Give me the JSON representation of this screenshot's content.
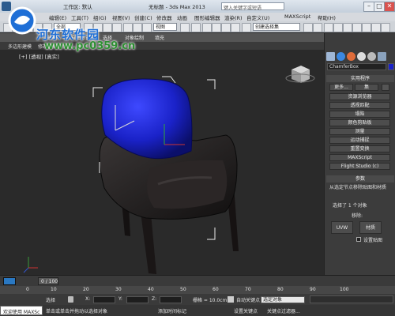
{
  "title_bar": {
    "workspace_label": "工作区: 默认",
    "file_title": "无标题 - 3ds Max 2013",
    "search_placeholder": "键入关键字或短语",
    "minimize": "–",
    "maximize": "□",
    "close": "✕"
  },
  "menu": {
    "items": [
      "编辑(E)",
      "工具(T)",
      "组(G)",
      "视图(V)",
      "创建(C)",
      "修改器",
      "动画",
      "图形编辑器",
      "渲染(R)",
      "自定义(U)",
      "MAXScript",
      "帮助(H)"
    ]
  },
  "toolbar": {
    "filter_combo": "全部",
    "view_combo": "视图",
    "selection_set": "创建选择集"
  },
  "ribbon": {
    "items": [
      "建模",
      "自由形式",
      "选择",
      "对象绘制",
      "填充"
    ],
    "sub_items": [
      "多边形建模",
      "修改选择",
      "默认"
    ]
  },
  "viewport": {
    "label": "[+] [透视] [真实]"
  },
  "command_panel": {
    "object_name": "ChamferBox",
    "rollout_utilities": "实用程序",
    "more_button": "更多...",
    "sets_button": "集",
    "buttons": [
      "资源浏览器",
      "透视匹配",
      "塌陷",
      "颜色剪贴板",
      "测量",
      "运动捕捉",
      "重置变换",
      "MAXScript",
      "Flight Studio (c)"
    ],
    "rollout_params": "参数",
    "param_desc": "从选定节点移除贴图和材质",
    "selected_count": "选择了 1 个对象",
    "remove_label": "移除:",
    "uvw_button": "UVW",
    "material_button": "材质",
    "checkbox_label": "设置贴图"
  },
  "timeline": {
    "frame": "0 / 100",
    "ticks": [
      "0",
      "10",
      "20",
      "30",
      "40",
      "50",
      "60",
      "70",
      "80",
      "90",
      "100"
    ]
  },
  "status": {
    "welcome": "欢迎使用 MAXSc",
    "hint": "单击或单击并拖动以选择对象",
    "selected_label": "选择",
    "x_label": "X:",
    "y_label": "Y:",
    "z_label": "Z:",
    "grid": "栅格 = 10.0cm",
    "autokey": "自动关键点",
    "selected_obj": "选定对象",
    "setkey": "设置关键点",
    "keyfilter": "关键点过滤器...",
    "add_time_tag": "添加时间标记"
  },
  "watermark": {
    "site": "www.pc0359.cn",
    "brand": "河东软件园"
  }
}
